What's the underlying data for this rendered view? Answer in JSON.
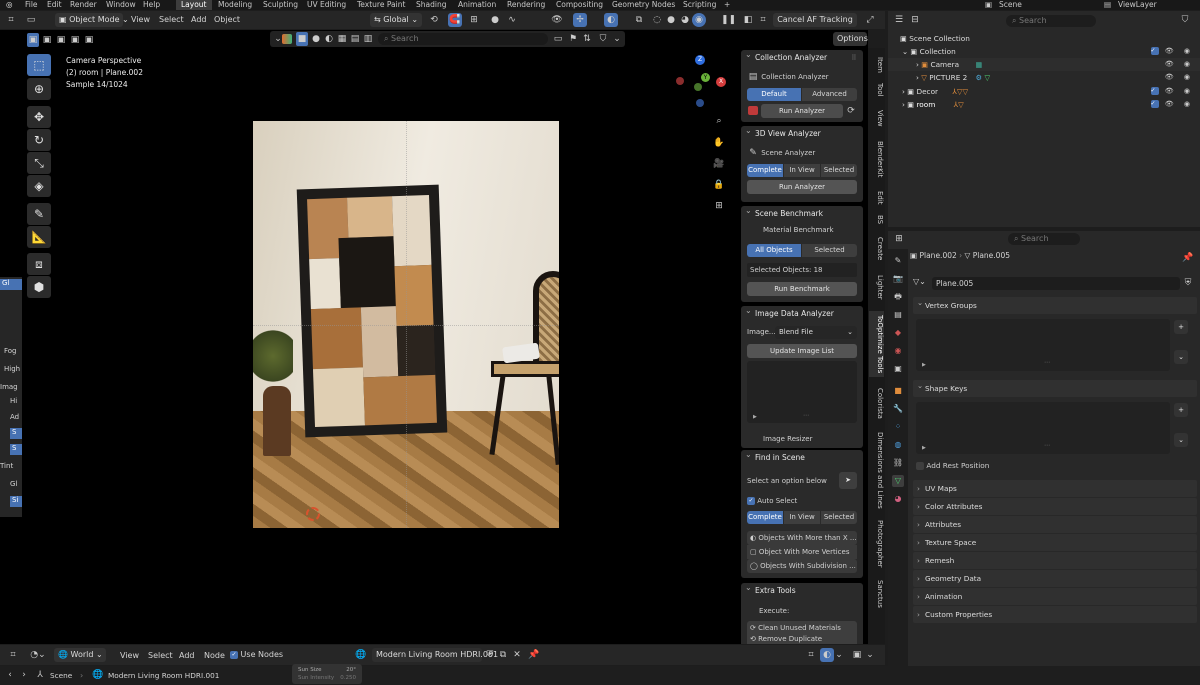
{
  "topbar": {
    "menus": [
      "File",
      "Edit",
      "Render",
      "Window",
      "Help"
    ],
    "workspaces": [
      "Layout",
      "Modeling",
      "Sculpting",
      "UV Editing",
      "Texture Paint",
      "Shading",
      "Animation",
      "Rendering",
      "Compositing",
      "Geometry Nodes",
      "Scripting"
    ],
    "active_workspace": "Layout",
    "scene": "Scene",
    "view_layer": "ViewLayer"
  },
  "viewport_header": {
    "mode": "Object Mode",
    "menus": [
      "View",
      "Select",
      "Add",
      "Object"
    ],
    "transform": "Global",
    "cancel_af": "Cancel AF Tracking",
    "search_placeholder": "Search",
    "options": "Options"
  },
  "overlay": {
    "line1": "Camera Perspective",
    "line2": "(2) room | Plane.002",
    "line3": "Sample 14/1024"
  },
  "gizmo": {
    "x": "X",
    "y": "Y",
    "z": "Z"
  },
  "left_clip": {
    "labels": [
      "Fog",
      "High",
      "Imag",
      "Hi",
      "Ad",
      "S",
      "S",
      "Tint",
      "Gl",
      "Si"
    ]
  },
  "collection_analyzer": {
    "title": "Collection Analyzer",
    "label": "Collection Analyzer",
    "seg": [
      "Default",
      "Advanced"
    ],
    "run": "Run Analyzer"
  },
  "view3d_analyzer": {
    "title": "3D View Analyzer",
    "label": "Scene Analyzer",
    "seg": [
      "Complete",
      "In View",
      "Selected"
    ],
    "run": "Run Analyzer"
  },
  "benchmark": {
    "title": "Scene Benchmark",
    "sub": "Material Benchmark",
    "seg": [
      "All Objects",
      "Selected Obje..."
    ],
    "selected": "Selected Objects: 18",
    "run": "Run Benchmark"
  },
  "image_data": {
    "title": "Image Data Analyzer",
    "image_label": "Image...",
    "blend": "Blend File",
    "update": "Update Image List",
    "resizer": "Image Resizer"
  },
  "find_scene": {
    "title": "Find in Scene",
    "select_opt": "Select an option below",
    "auto_select": "Auto Select",
    "seg": [
      "Complete",
      "In View",
      "Selected"
    ],
    "opts": [
      "Objects With More than X ...",
      "Object With More Vertices",
      "Objects With Subdivision ..."
    ]
  },
  "extra_tools": {
    "title": "Extra Tools",
    "execute": "Execute:",
    "items": [
      "Clean Unused Materials",
      "Remove Duplicate Materia..."
    ]
  },
  "side_tabs": [
    "Item",
    "Tool",
    "View",
    "BlenderKit",
    "Edit",
    "BS",
    "Create",
    "Lighter",
    "ToOptimize Tools",
    "Colorista",
    "Dimensions and Lines",
    "Photographer",
    "Sanctus"
  ],
  "outliner": {
    "search": "Search",
    "rows": [
      {
        "label": "Scene Collection"
      },
      {
        "label": "Collection"
      },
      {
        "label": "Camera"
      },
      {
        "label": "PICTURE 2"
      },
      {
        "label": "Decor"
      },
      {
        "label": "room"
      }
    ]
  },
  "properties": {
    "search": "Search",
    "breadcrumb1": "Plane.002",
    "breadcrumb2": "Plane.005",
    "mesh_name": "Plane.005",
    "sections": [
      "Vertex Groups",
      "Shape Keys",
      "UV Maps",
      "Color Attributes",
      "Attributes",
      "Texture Space",
      "Remesh",
      "Geometry Data",
      "Animation",
      "Custom Properties"
    ],
    "add_rest": "Add Rest Position"
  },
  "world_bar": {
    "type": "World",
    "menus": [
      "View",
      "Select",
      "Add",
      "Node"
    ],
    "use_nodes": "Use Nodes",
    "world_name": "Modern Living Room HDRI.001"
  },
  "status": {
    "scene": "Scene",
    "world": "Modern Living Room HDRI.001",
    "sun_size": "Sun Size",
    "sun_size_val": "20°",
    "sun_intensity": "Sun Intensity",
    "sun_int_val": "0.250"
  },
  "colors": {
    "accent": "#4772b3",
    "panel": "#2a2a2a",
    "bg": "#1d1d1d"
  }
}
